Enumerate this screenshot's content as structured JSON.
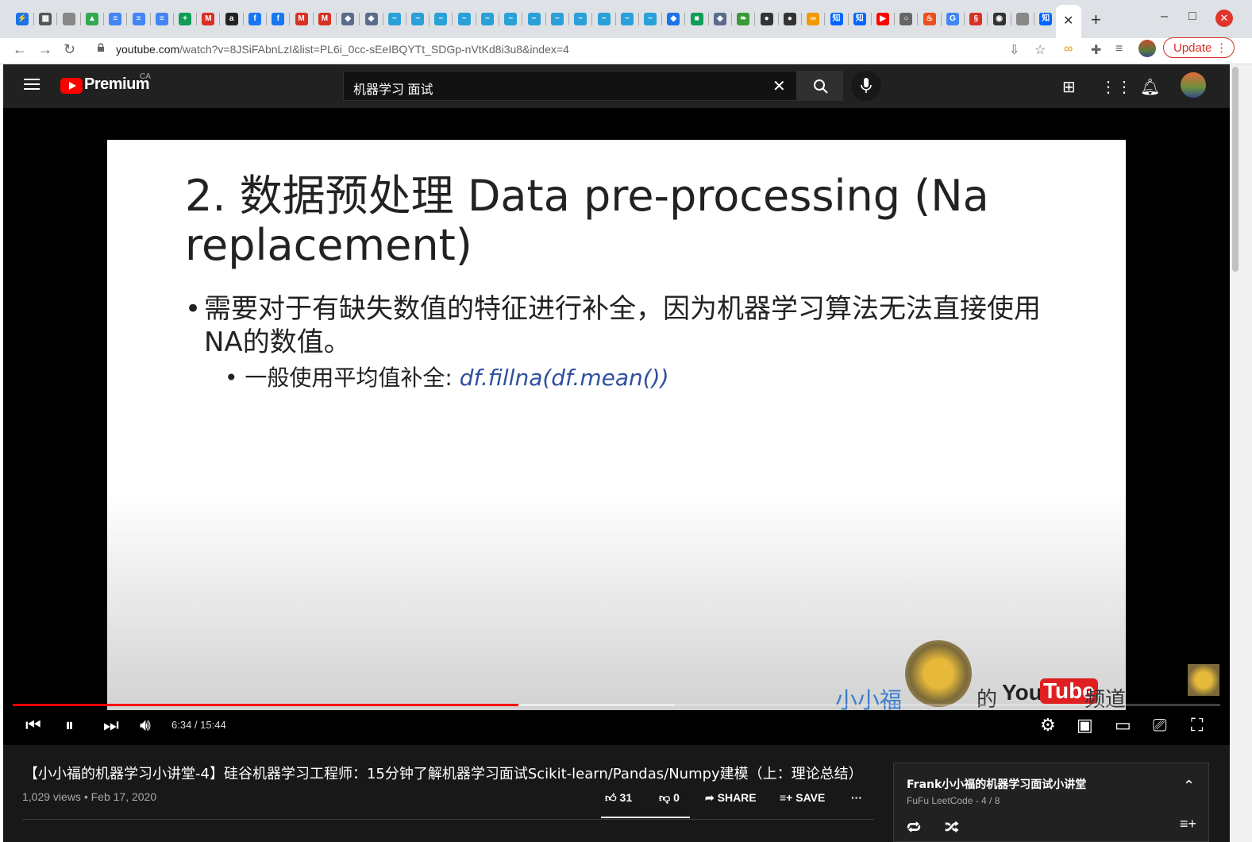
{
  "browser": {
    "tab_favicons": [
      {
        "icon": "bolt-icon",
        "color": "#1a73e8",
        "glyph": "⚡"
      },
      {
        "icon": "photo-icon",
        "color": "#555",
        "glyph": "▦"
      },
      {
        "icon": "blank-icon",
        "color": "#888",
        "glyph": ""
      },
      {
        "icon": "drive-icon",
        "color": "#34a853",
        "glyph": "▲"
      },
      {
        "icon": "docs-icon",
        "color": "#4285f4",
        "glyph": "≡"
      },
      {
        "icon": "docs-icon",
        "color": "#4285f4",
        "glyph": "≡"
      },
      {
        "icon": "docs-icon",
        "color": "#4285f4",
        "glyph": "≡"
      },
      {
        "icon": "sheets-icon",
        "color": "#0f9d58",
        "glyph": "+"
      },
      {
        "icon": "gmail-icon",
        "color": "#d93025",
        "glyph": "M"
      },
      {
        "icon": "amazon-icon",
        "color": "#222",
        "glyph": "a"
      },
      {
        "icon": "facebook-icon",
        "color": "#1877f2",
        "glyph": "f"
      },
      {
        "icon": "facebook-icon",
        "color": "#1877f2",
        "glyph": "f"
      },
      {
        "icon": "gmail-icon",
        "color": "#d93025",
        "glyph": "M"
      },
      {
        "icon": "gmail-icon",
        "color": "#d93025",
        "glyph": "M"
      },
      {
        "icon": "cube-icon",
        "color": "#5a6b8c",
        "glyph": "◆"
      },
      {
        "icon": "cube-icon",
        "color": "#5a6b8c",
        "glyph": "◆"
      },
      {
        "icon": "bird-icon",
        "color": "#2aa0d8",
        "glyph": "~"
      },
      {
        "icon": "bird-icon",
        "color": "#2aa0d8",
        "glyph": "~"
      },
      {
        "icon": "bird-icon",
        "color": "#2aa0d8",
        "glyph": "~"
      },
      {
        "icon": "bird-icon",
        "color": "#2aa0d8",
        "glyph": "~"
      },
      {
        "icon": "bird-icon",
        "color": "#2aa0d8",
        "glyph": "~"
      },
      {
        "icon": "bird-icon",
        "color": "#2aa0d8",
        "glyph": "~"
      },
      {
        "icon": "bird-icon",
        "color": "#2aa0d8",
        "glyph": "~"
      },
      {
        "icon": "bird-icon",
        "color": "#2aa0d8",
        "glyph": "~"
      },
      {
        "icon": "bird-icon",
        "color": "#2aa0d8",
        "glyph": "~"
      },
      {
        "icon": "bird-icon",
        "color": "#2aa0d8",
        "glyph": "~"
      },
      {
        "icon": "bird-icon",
        "color": "#2aa0d8",
        "glyph": "~"
      },
      {
        "icon": "bird-icon",
        "color": "#2aa0d8",
        "glyph": "~"
      },
      {
        "icon": "diamond-icon",
        "color": "#1a73e8",
        "glyph": "◆"
      },
      {
        "icon": "square-green-icon",
        "color": "#0f9d58",
        "glyph": "■"
      },
      {
        "icon": "cube-icon",
        "color": "#5a6b8c",
        "glyph": "◆"
      },
      {
        "icon": "leaf-icon",
        "color": "#3a9a3a",
        "glyph": "❧"
      },
      {
        "icon": "github-icon",
        "color": "#333",
        "glyph": "●"
      },
      {
        "icon": "github-icon",
        "color": "#333",
        "glyph": "●"
      },
      {
        "icon": "infinity-icon",
        "color": "#f29900",
        "glyph": "∞"
      },
      {
        "icon": "zhihu-icon",
        "color": "#0066ff",
        "glyph": "知"
      },
      {
        "icon": "zhihu-icon",
        "color": "#0066ff",
        "glyph": "知"
      },
      {
        "icon": "youtube-icon",
        "color": "#ff0000",
        "glyph": "▶"
      },
      {
        "icon": "circle-icon",
        "color": "#666",
        "glyph": "○"
      },
      {
        "icon": "flame-icon",
        "color": "#e8501c",
        "glyph": "♨"
      },
      {
        "icon": "google-icon",
        "color": "#4285f4",
        "glyph": "G"
      },
      {
        "icon": "red-icon",
        "color": "#d93025",
        "glyph": "§"
      },
      {
        "icon": "search-dark-icon",
        "color": "#333",
        "glyph": "◉"
      },
      {
        "icon": "blank-icon",
        "color": "#888",
        "glyph": ""
      },
      {
        "icon": "zhihu-icon",
        "color": "#0066ff",
        "glyph": "知"
      }
    ],
    "url_domain": "youtube.com",
    "url_path": "/watch?v=8JSiFAbnLzI&list=PL6i_0cc-sEeIBQYTt_SDGp-nVtKd8i3u8&index=4",
    "update_label": "Update"
  },
  "youtube": {
    "brand": "Premium",
    "region": "CA",
    "search_query": "机器学习 面试"
  },
  "slide": {
    "title": "2. 数据预处理 Data pre-processing (Na replacement)",
    "bullet1": "需要对于有缺失数值的特征进行补全，因为机器学习算法无法直接使用NA的数值。",
    "bullet2_text": "一般使用平均值补全: ",
    "bullet2_code": "df.fillna(df.mean())",
    "watermark_left": "小小福",
    "watermark_de": "的",
    "watermark_you": "You",
    "watermark_tube": "Tube",
    "watermark_channel": "频道"
  },
  "player": {
    "time": "6:34 / 15:44",
    "played_fraction": 0.419,
    "loaded_fraction": 0.548
  },
  "video": {
    "title": "【小小福的机器学习小讲堂-4】硅谷机器学习工程师：15分钟了解机器学习面试Scikit-learn/Pandas/Numpy建模（上：理论总结）",
    "views_date": "1,029 views • Feb 17, 2020",
    "likes": "31",
    "dislikes": "0",
    "share_label": "SHARE",
    "save_label": "SAVE"
  },
  "playlist": {
    "title": "Frank小小福的机器学习面试小讲堂",
    "subtitle": "FuFu LeetCode - 4 / 8"
  }
}
